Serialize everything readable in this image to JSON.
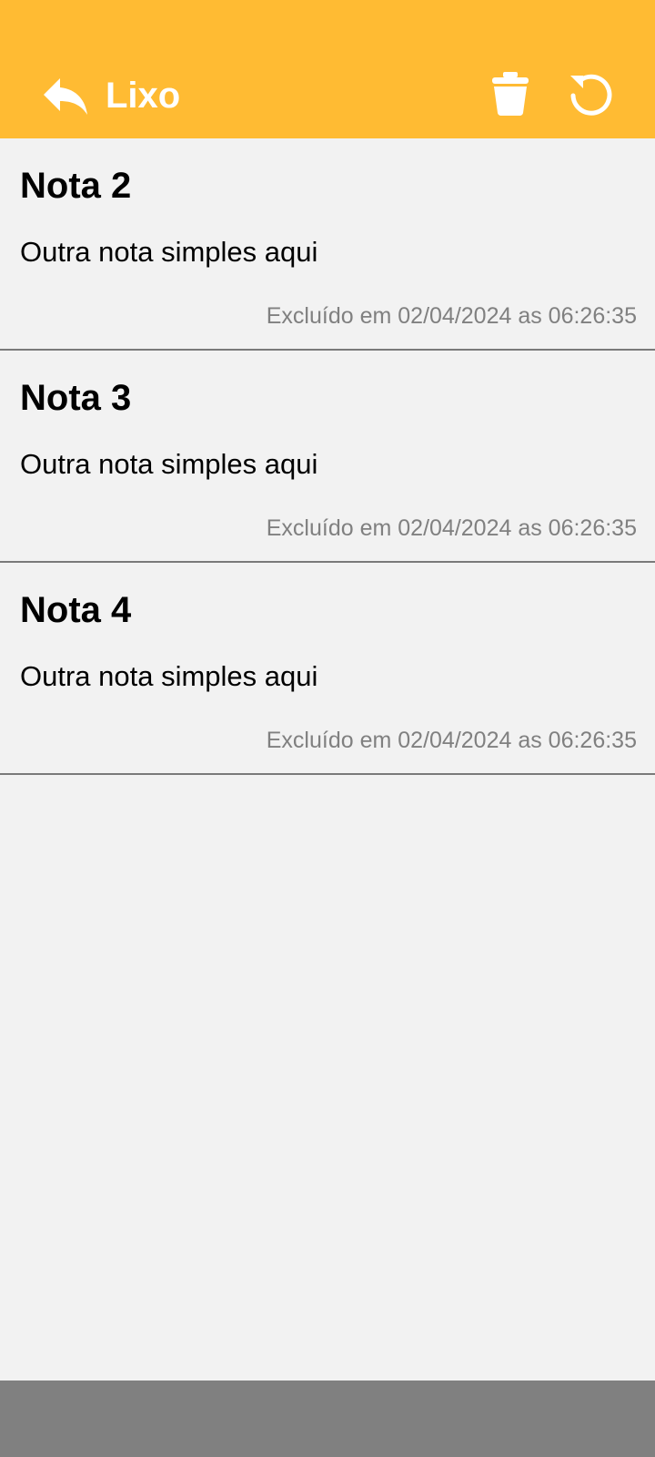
{
  "header": {
    "title": "Lixo",
    "background_color": "#ffbb33",
    "back_icon": "reply-arrow-icon",
    "empty_trash_icon": "trash-icon",
    "restore_icon": "restore-icon"
  },
  "notes": [
    {
      "title": "Nota 2",
      "body": "Outra nota simples aqui",
      "deleted_at": "Excluído em 02/04/2024 as 06:26:35"
    },
    {
      "title": "Nota 3",
      "body": "Outra nota simples aqui",
      "deleted_at": "Excluído em 02/04/2024 as 06:26:35"
    },
    {
      "title": "Nota 4",
      "body": "Outra nota simples aqui",
      "deleted_at": "Excluído em 02/04/2024 as 06:26:35"
    }
  ],
  "colors": {
    "background": "#f2f2f2",
    "divider": "#7a7a7a",
    "date_text": "#808080",
    "nav_bar": "#808080"
  }
}
